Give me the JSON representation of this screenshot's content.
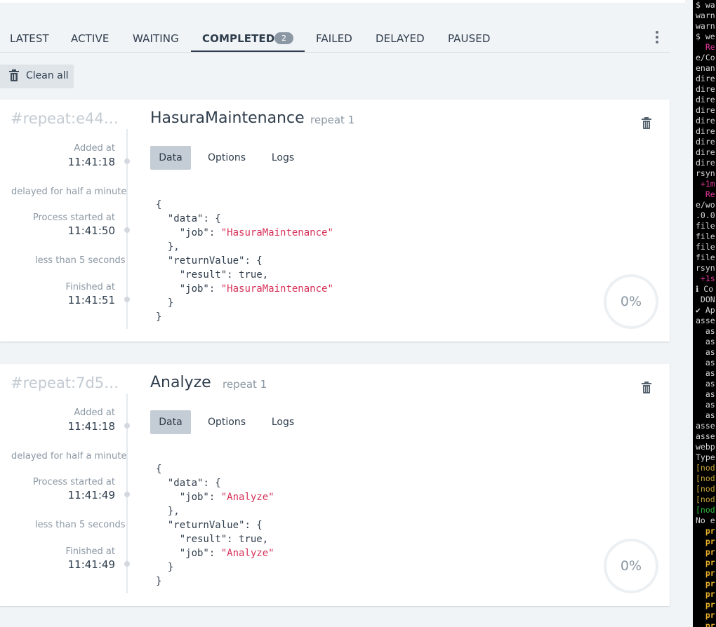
{
  "tabs": [
    {
      "label": "LATEST"
    },
    {
      "label": "ACTIVE"
    },
    {
      "label": "WAITING"
    },
    {
      "label": "COMPLETED",
      "badge": "2"
    },
    {
      "label": "FAILED"
    },
    {
      "label": "DELAYED"
    },
    {
      "label": "PAUSED"
    }
  ],
  "toolbar": {
    "clean_label": "Clean all"
  },
  "jobs": [
    {
      "id": "#repeat:e44…",
      "name": "HasuraMaintenance",
      "meta": "repeat 1",
      "added_label": "Added at",
      "added_time": "11:41:18",
      "delay_note": "delayed for half a minute",
      "started_label": "Process started at",
      "started_time": "11:41:50",
      "duration_note": "less than 5 seconds",
      "finished_label": "Finished at",
      "finished_time": "11:41:51",
      "subtabs": [
        "Data",
        "Options",
        "Logs"
      ],
      "code": {
        "open": "{",
        "data_key": "\"data\"",
        "job_key": "\"job\"",
        "job_value": "\"HasuraMaintenance\"",
        "return_key": "\"returnValue\"",
        "result_key": "\"result\"",
        "result_value": "true",
        "close": "}"
      },
      "progress": "0%"
    },
    {
      "id": "#repeat:7d5…",
      "name": "Analyze",
      "meta": "repeat 1",
      "added_label": "Added at",
      "added_time": "11:41:18",
      "delay_note": "delayed for half a minute",
      "started_label": "Process started at",
      "started_time": "11:41:49",
      "duration_note": "less than 5 seconds",
      "finished_label": "Finished at",
      "finished_time": "11:41:49",
      "subtabs": [
        "Data",
        "Options",
        "Logs"
      ],
      "code": {
        "open": "{",
        "data_key": "\"data\"",
        "job_key": "\"job\"",
        "job_value": "\"Analyze\"",
        "return_key": "\"returnValue\"",
        "result_key": "\"result\"",
        "result_value": "true",
        "close": "}"
      },
      "progress": "0%"
    }
  ],
  "terminal": {
    "lines": [
      {
        "t": "$ wa",
        "c": ""
      },
      {
        "t": "warn",
        "c": ""
      },
      {
        "t": "warn",
        "c": ""
      },
      {
        "t": "$ we",
        "c": ""
      },
      {
        "t": "  Re",
        "c": "t-pink"
      },
      {
        "t": "e/Co",
        "c": ""
      },
      {
        "t": "enan",
        "c": ""
      },
      {
        "t": "dire",
        "c": ""
      },
      {
        "t": "dire",
        "c": ""
      },
      {
        "t": "dire",
        "c": ""
      },
      {
        "t": "dire",
        "c": ""
      },
      {
        "t": "dire",
        "c": ""
      },
      {
        "t": "dire",
        "c": ""
      },
      {
        "t": "dire",
        "c": ""
      },
      {
        "t": "dire",
        "c": ""
      },
      {
        "t": "dire",
        "c": ""
      },
      {
        "t": "rsyn",
        "c": ""
      },
      {
        "t": " +1m",
        "c": "t-pink"
      },
      {
        "t": "  Re",
        "c": "t-pink"
      },
      {
        "t": "e/wo",
        "c": ""
      },
      {
        "t": ".0.0",
        "c": ""
      },
      {
        "t": "file",
        "c": ""
      },
      {
        "t": "file",
        "c": ""
      },
      {
        "t": "file",
        "c": ""
      },
      {
        "t": "file",
        "c": ""
      },
      {
        "t": "rsyn",
        "c": ""
      },
      {
        "t": " +1s",
        "c": "t-pink"
      },
      {
        "t": "ℹ Co",
        "c": ""
      },
      {
        "t": " DON",
        "c": ""
      },
      {
        "t": "✔ Ap",
        "c": ""
      },
      {
        "t": "asse",
        "c": ""
      },
      {
        "t": "  as",
        "c": ""
      },
      {
        "t": "  as",
        "c": ""
      },
      {
        "t": "  as",
        "c": ""
      },
      {
        "t": "  as",
        "c": ""
      },
      {
        "t": "  as",
        "c": ""
      },
      {
        "t": "  as",
        "c": ""
      },
      {
        "t": "  as",
        "c": ""
      },
      {
        "t": "  as",
        "c": ""
      },
      {
        "t": "  as",
        "c": ""
      },
      {
        "t": "asse",
        "c": ""
      },
      {
        "t": "asse",
        "c": ""
      },
      {
        "t": "webp",
        "c": ""
      },
      {
        "t": "Type",
        "c": ""
      },
      {
        "t": "[nod",
        "c": "t-brown"
      },
      {
        "t": "[nod",
        "c": "t-brown"
      },
      {
        "t": "[nod",
        "c": "t-brown"
      },
      {
        "t": "[nod",
        "c": "t-brown"
      },
      {
        "t": "[nod",
        "c": "t-green"
      },
      {
        "t": "No e",
        "c": ""
      },
      {
        "t": "  pr",
        "c": "t-yel"
      },
      {
        "t": "  pr",
        "c": "t-yel"
      },
      {
        "t": "  pr",
        "c": "t-yel"
      },
      {
        "t": "  pr",
        "c": "t-yel"
      },
      {
        "t": "  pr",
        "c": "t-yel"
      },
      {
        "t": "  pr",
        "c": "t-yel"
      },
      {
        "t": "  pr",
        "c": "t-yel"
      },
      {
        "t": "  pr",
        "c": "t-yel"
      },
      {
        "t": "  pr",
        "c": "t-yel"
      },
      {
        "t": "  pr",
        "c": "t-yel"
      }
    ]
  }
}
